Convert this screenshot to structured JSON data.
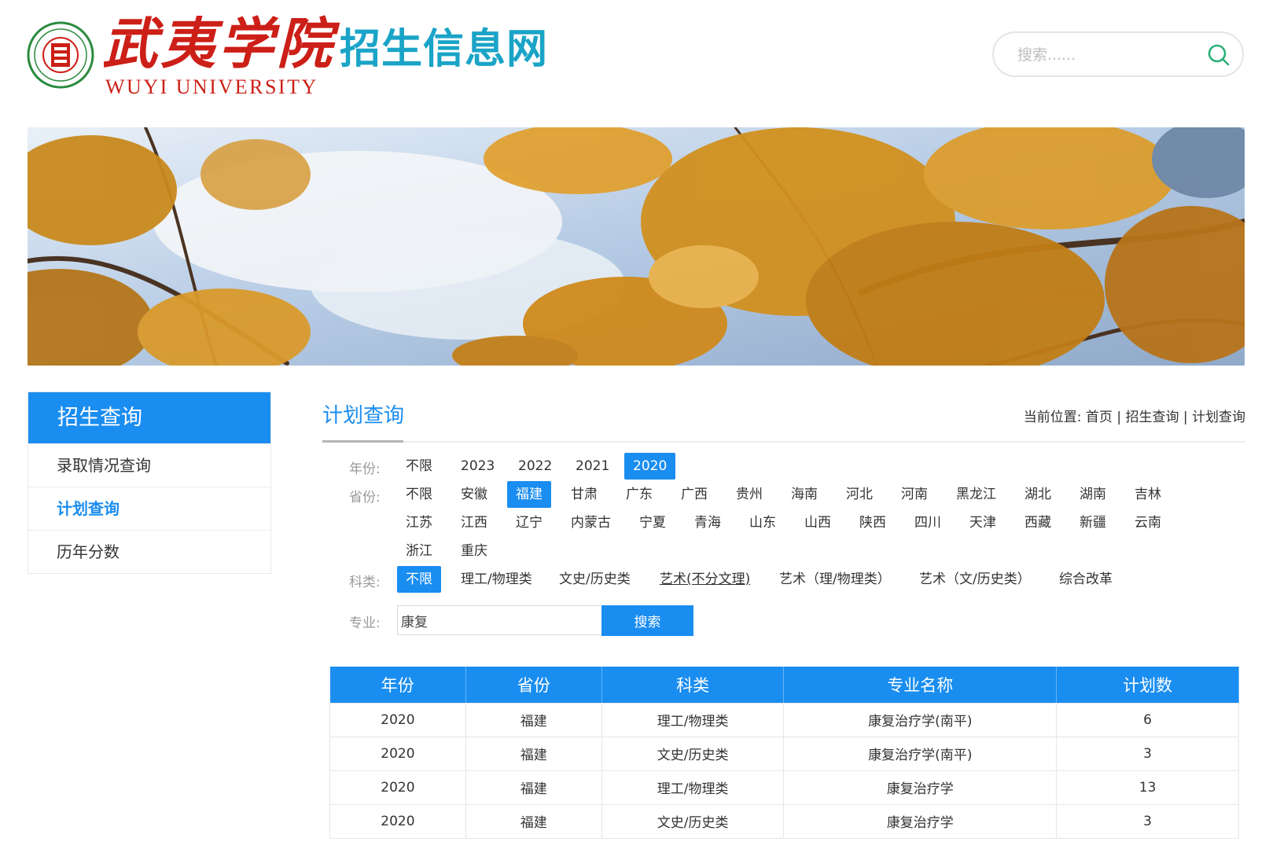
{
  "header": {
    "university_name_cn": "武夷学院",
    "university_name_en": "WUYI UNIVERSITY",
    "site_title": "招生信息网",
    "search_placeholder": "搜索......",
    "brand_color": "#cc1f17",
    "title_color": "#1aa4c7"
  },
  "banner": {
    "icon": "ginkgo-banner-image"
  },
  "sidebar": {
    "title": "招生查询",
    "items": [
      {
        "label": "录取情况查询",
        "active": false
      },
      {
        "label": "计划查询",
        "active": true
      },
      {
        "label": "历年分数",
        "active": false
      }
    ]
  },
  "main": {
    "title": "计划查询",
    "breadcrumb": {
      "prefix": "当前位置:",
      "home": "首页",
      "section": "招生查询",
      "current": "计划查询",
      "separator": "|"
    },
    "filters": {
      "year_label": "年份:",
      "years": [
        "不限",
        "2023",
        "2022",
        "2021",
        "2020"
      ],
      "year_selected": "2020",
      "province_label": "省份:",
      "provinces": [
        "不限",
        "安徽",
        "福建",
        "甘肃",
        "广东",
        "广西",
        "贵州",
        "海南",
        "河北",
        "河南",
        "黑龙江",
        "湖北",
        "湖南",
        "吉林",
        "江苏",
        "江西",
        "辽宁",
        "内蒙古",
        "宁夏",
        "青海",
        "山东",
        "山西",
        "陕西",
        "四川",
        "天津",
        "西藏",
        "新疆",
        "云南",
        "浙江",
        "重庆"
      ],
      "province_selected": "福建",
      "category_label": "科类:",
      "categories": [
        "不限",
        "理工/物理类",
        "文史/历史类",
        "艺术(不分文理)",
        "艺术（理/物理类）",
        "艺术（文/历史类）",
        "综合改革"
      ],
      "category_selected": "不限",
      "major_label": "专业:",
      "major_value": "康复",
      "search_button": "搜索"
    },
    "table": {
      "columns": [
        "年份",
        "省份",
        "科类",
        "专业名称",
        "计划数"
      ],
      "rows": [
        [
          "2020",
          "福建",
          "理工/物理类",
          "康复治疗学(南平)",
          "6"
        ],
        [
          "2020",
          "福建",
          "文史/历史类",
          "康复治疗学(南平)",
          "3"
        ],
        [
          "2020",
          "福建",
          "理工/物理类",
          "康复治疗学",
          "13"
        ],
        [
          "2020",
          "福建",
          "文史/历史类",
          "康复治疗学",
          "3"
        ]
      ]
    }
  },
  "colors": {
    "accent": "#1a8df0"
  }
}
